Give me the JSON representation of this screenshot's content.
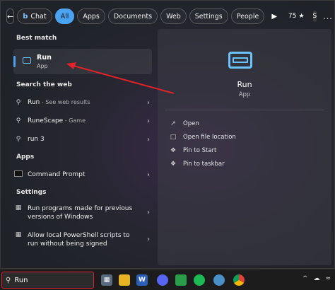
{
  "filters": {
    "chat": "Chat",
    "all": "All",
    "apps": "Apps",
    "documents": "Documents",
    "web": "Web",
    "settings": "Settings",
    "people": "People",
    "points": "75",
    "profile_initial": "S",
    "more": "...",
    "bing": "b"
  },
  "left": {
    "best_match_title": "Best match",
    "best_match": {
      "name": "Run",
      "kind": "App"
    },
    "search_web_title": "Search the web",
    "web_results": [
      {
        "text": "Run",
        "suffix": " - See web results"
      },
      {
        "text": "RuneScape",
        "suffix": " - Game"
      },
      {
        "text": "run 3",
        "suffix": ""
      }
    ],
    "apps_title": "Apps",
    "apps": [
      {
        "text": "Command Prompt"
      }
    ],
    "settings_title": "Settings",
    "settings": [
      {
        "line1": "Run programs made for previous",
        "line2": "versions of Windows"
      },
      {
        "line1": "Allow local PowerShell scripts to",
        "line2": "run without being signed"
      }
    ]
  },
  "right": {
    "app_name": "Run",
    "app_kind": "App",
    "actions": [
      "Open",
      "Open file location",
      "Pin to Start",
      "Pin to taskbar"
    ]
  },
  "taskbar": {
    "search_value": "Run",
    "word_icon": "W",
    "tray_more": "^"
  },
  "colors": {
    "accent": "#4aa3f0",
    "annotation_red": "#e0222a",
    "run_icon": "#6cc4ff"
  }
}
